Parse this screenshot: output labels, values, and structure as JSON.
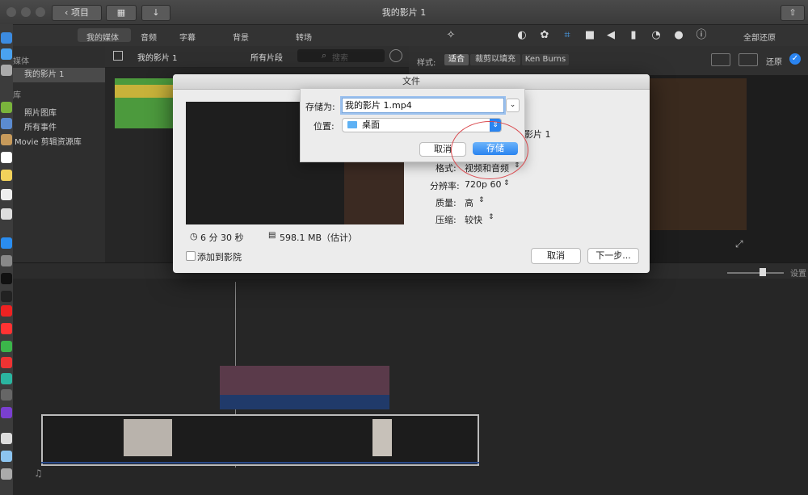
{
  "window": {
    "title": "我的影片 1",
    "back_label": "项目"
  },
  "media_tabs": [
    "我的媒体",
    "音频",
    "字幕",
    "背景",
    "转场"
  ],
  "viewer_toolbar": {
    "reset_all": "全部还原",
    "style_label": "样式:",
    "style_options": [
      "适合",
      "裁剪以填充",
      "Ken Burns"
    ],
    "reset": "还原"
  },
  "library": {
    "section1": "媒体",
    "project": "我的影片 1",
    "section2": "库",
    "items": [
      "照片图库",
      "所有事件",
      "Movie 剪辑资源库"
    ]
  },
  "browser": {
    "title": "我的影片 1",
    "filter": "所有片段",
    "search_placeholder": "搜索"
  },
  "timeline": {
    "settings": "设置"
  },
  "dialog": {
    "title": "文件",
    "duration": "6 分 30 秒",
    "size": "598.1 MB（估计）",
    "add_to_theater": "添加到影院",
    "name_partial": "影片 1",
    "format_label": "格式:",
    "format_value": "视频和音频",
    "resolution_label": "分辨率:",
    "resolution_value": "720p 60",
    "quality_label": "质量:",
    "quality_value": "高",
    "compress_label": "压缩:",
    "compress_value": "较快",
    "cancel": "取消",
    "next": "下一步..."
  },
  "save_sheet": {
    "save_as_label": "存储为:",
    "filename": "我的影片 1.mp4",
    "where_label": "位置:",
    "where_value": "桌面",
    "cancel": "取消",
    "save": "存储"
  }
}
